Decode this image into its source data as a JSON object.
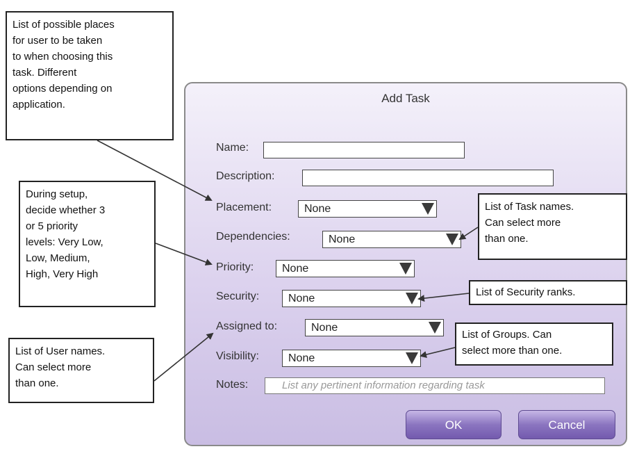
{
  "dialog": {
    "title": "Add Task",
    "name_label": "Name:",
    "description_label": "Description:",
    "placement_label": "Placement:",
    "placement_value": "None",
    "dependencies_label": "Dependencies:",
    "dependencies_value": "None",
    "priority_label": "Priority:",
    "priority_value": "None",
    "security_label": "Security:",
    "security_value": "None",
    "assigned_label": "Assigned to:",
    "assigned_value": "None",
    "visibility_label": "Visibility:",
    "visibility_value": "None",
    "notes_label": "Notes:",
    "notes_placeholder": "List any pertinent information regarding task",
    "ok_label": "OK",
    "cancel_label": "Cancel"
  },
  "notes": {
    "placement": [
      "List of possible places",
      "for user to be taken",
      "to when choosing this",
      "task. Different",
      "options depending on",
      "application."
    ],
    "priority": [
      "During setup,",
      "decide whether 3",
      "or 5 priority",
      "levels: Very Low,",
      "Low, Medium,",
      "High, Very High"
    ],
    "users": [
      "List of User names.",
      "Can select more",
      "than one."
    ],
    "tasks": [
      "List of Task names.",
      "Can select more",
      "than one."
    ],
    "security": [
      "List of Security ranks."
    ],
    "groups": [
      "List of Groups. Can",
      "select more than one."
    ]
  }
}
